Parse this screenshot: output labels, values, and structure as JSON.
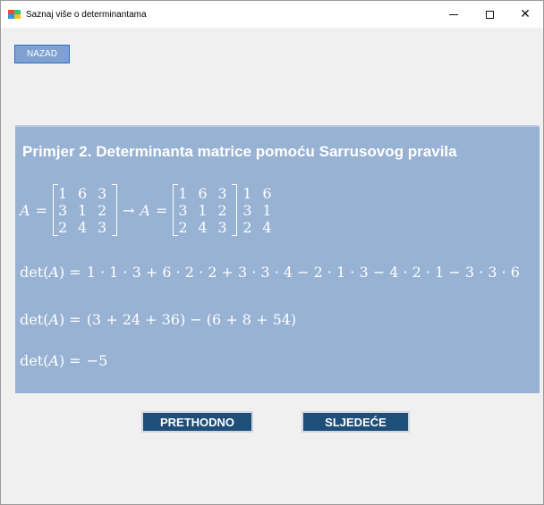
{
  "window": {
    "title": "Saznaj više o determinantama",
    "controls": {
      "minimize": "—",
      "maximize": "□",
      "close": "✕"
    }
  },
  "toolbar": {
    "back_label": "NAZAD"
  },
  "example": {
    "title": "Primjer 2. Determinanta matrice pomoću Sarrusovog pravila",
    "matrix_label": "A",
    "equals": "=",
    "arrow": "→",
    "matrix": [
      [
        "1",
        "6",
        "3"
      ],
      [
        "3",
        "1",
        "2"
      ],
      [
        "2",
        "4",
        "3"
      ]
    ],
    "extra_columns": [
      [
        "1",
        "6"
      ],
      [
        "3",
        "1"
      ],
      [
        "2",
        "4"
      ]
    ],
    "det_prefix": "det(A) =",
    "line1": "1 · 1 · 3 + 6 · 2 · 2 + 3 · 3 · 4 − 2 · 1 · 3 − 4 · 2 · 1 − 3 · 3 · 6",
    "line2": "(3 + 24 + 36) − (6 + 8 + 54)",
    "line3": "−5"
  },
  "navigation": {
    "prev_label": "PRETHODNO",
    "next_label": "SLJEDEĆE"
  }
}
